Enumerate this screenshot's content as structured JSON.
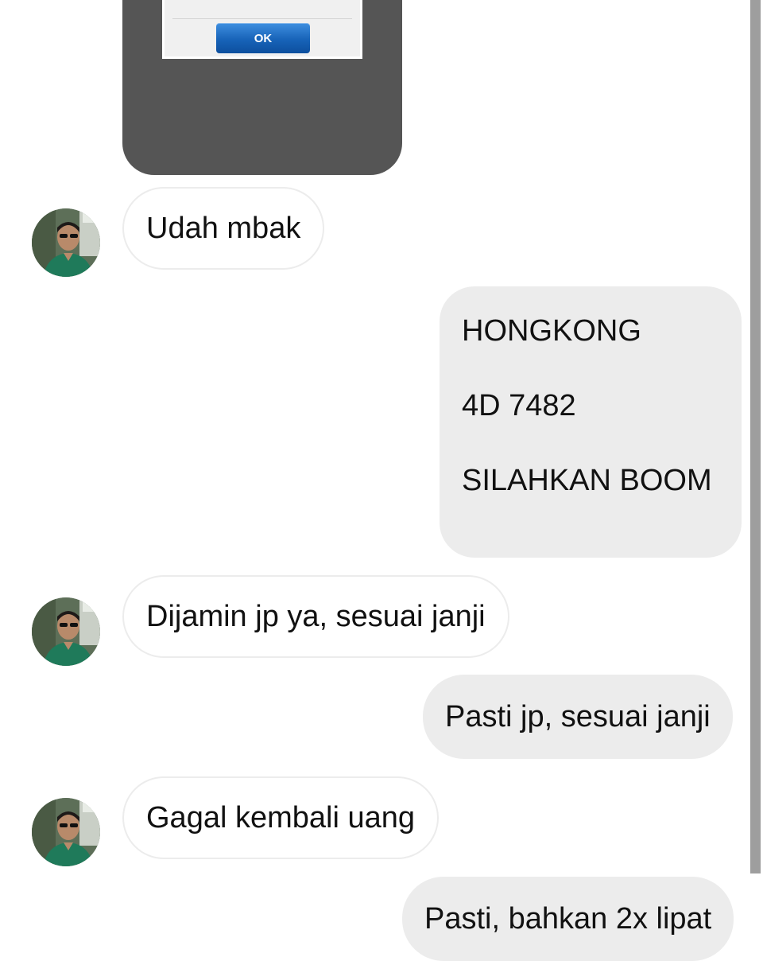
{
  "image_message": {
    "dialog_button_label": "OK"
  },
  "messages": {
    "m1": {
      "text": "Udah mbak"
    },
    "m2": {
      "lines": [
        "HONGKONG",
        "4D 7482",
        "SILAHKAN BOOM"
      ]
    },
    "m3": {
      "text": "Dijamin jp ya, sesuai janji"
    },
    "m4": {
      "text": "Pasti jp, sesuai janji"
    },
    "m5": {
      "text": "Gagal kembali uang"
    },
    "m6": {
      "text": "Pasti, bahkan 2x lipat"
    }
  },
  "colors": {
    "incoming_bubble_bg": "#ffffff",
    "incoming_bubble_border": "#ececec",
    "outgoing_bubble_bg": "#ececec",
    "image_frame_bg": "#555555",
    "ok_button_blue": "#1763b8",
    "scrollbar_thumb": "#9e9e9e"
  },
  "icons": {
    "avatar": "contact-avatar-photo"
  }
}
